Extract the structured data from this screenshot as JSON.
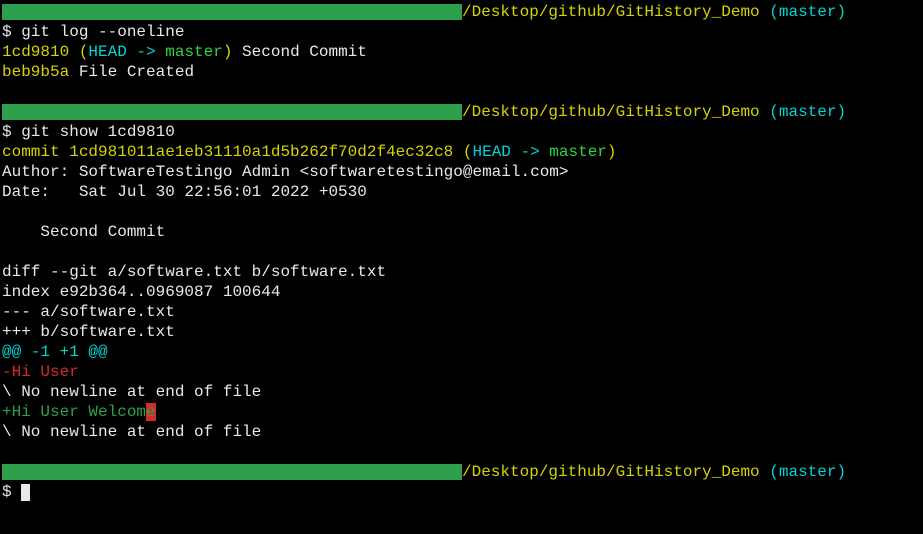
{
  "prompt1": {
    "path": "/Desktop/github/GitHistory_Demo",
    "branch": " (master)",
    "symbol": "$ ",
    "cmd": "git log --oneline"
  },
  "log": {
    "hash1": "1cd9810",
    "paren_open": " (",
    "head": "HEAD -> ",
    "master": "master",
    "paren_close": ")",
    "msg1": " Second Commit",
    "hash2": "beb9b5a",
    "msg2": " File Created"
  },
  "prompt2": {
    "path": "/Desktop/github/GitHistory_Demo",
    "branch": " (master)",
    "symbol": "$ ",
    "cmd": "git show 1cd9810"
  },
  "show": {
    "commit_label": "commit 1cd981011ae1eb31110a1d5b262f70d2f4ec32c8",
    "paren_open": " (",
    "head": "HEAD -> ",
    "master": "master",
    "paren_close": ")",
    "author": "Author: SoftwareTestingo Admin <softwaretestingo@email.com>",
    "date": "Date:   Sat Jul 30 22:56:01 2022 +0530",
    "message": "    Second Commit",
    "diff_header": "diff --git a/software.txt b/software.txt",
    "index": "index e92b364..0969087 100644",
    "minus_file": "--- a/software.txt",
    "plus_file": "+++ b/software.txt",
    "hunk": "@@ -1 +1 @@",
    "removed": "-Hi User",
    "no_newline1": "\\ No newline at end of file",
    "added_pre": "+Hi User Welcom",
    "added_cursor": "e",
    "no_newline2": "\\ No newline at end of file"
  },
  "prompt3": {
    "path": "/Desktop/github/GitHistory_Demo",
    "branch": " (master)",
    "symbol": "$ "
  }
}
